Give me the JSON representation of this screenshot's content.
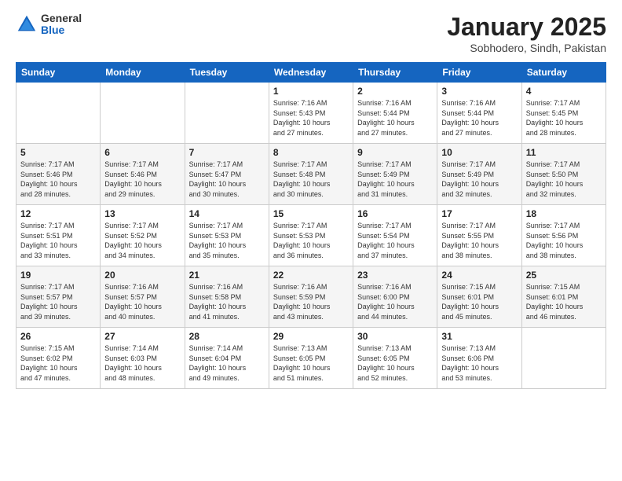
{
  "logo": {
    "general": "General",
    "blue": "Blue"
  },
  "header": {
    "title": "January 2025",
    "subtitle": "Sobhodero, Sindh, Pakistan"
  },
  "weekdays": [
    "Sunday",
    "Monday",
    "Tuesday",
    "Wednesday",
    "Thursday",
    "Friday",
    "Saturday"
  ],
  "weeks": [
    [
      {
        "day": "",
        "info": ""
      },
      {
        "day": "",
        "info": ""
      },
      {
        "day": "",
        "info": ""
      },
      {
        "day": "1",
        "info": "Sunrise: 7:16 AM\nSunset: 5:43 PM\nDaylight: 10 hours\nand 27 minutes."
      },
      {
        "day": "2",
        "info": "Sunrise: 7:16 AM\nSunset: 5:44 PM\nDaylight: 10 hours\nand 27 minutes."
      },
      {
        "day": "3",
        "info": "Sunrise: 7:16 AM\nSunset: 5:44 PM\nDaylight: 10 hours\nand 27 minutes."
      },
      {
        "day": "4",
        "info": "Sunrise: 7:17 AM\nSunset: 5:45 PM\nDaylight: 10 hours\nand 28 minutes."
      }
    ],
    [
      {
        "day": "5",
        "info": "Sunrise: 7:17 AM\nSunset: 5:46 PM\nDaylight: 10 hours\nand 28 minutes."
      },
      {
        "day": "6",
        "info": "Sunrise: 7:17 AM\nSunset: 5:46 PM\nDaylight: 10 hours\nand 29 minutes."
      },
      {
        "day": "7",
        "info": "Sunrise: 7:17 AM\nSunset: 5:47 PM\nDaylight: 10 hours\nand 30 minutes."
      },
      {
        "day": "8",
        "info": "Sunrise: 7:17 AM\nSunset: 5:48 PM\nDaylight: 10 hours\nand 30 minutes."
      },
      {
        "day": "9",
        "info": "Sunrise: 7:17 AM\nSunset: 5:49 PM\nDaylight: 10 hours\nand 31 minutes."
      },
      {
        "day": "10",
        "info": "Sunrise: 7:17 AM\nSunset: 5:49 PM\nDaylight: 10 hours\nand 32 minutes."
      },
      {
        "day": "11",
        "info": "Sunrise: 7:17 AM\nSunset: 5:50 PM\nDaylight: 10 hours\nand 32 minutes."
      }
    ],
    [
      {
        "day": "12",
        "info": "Sunrise: 7:17 AM\nSunset: 5:51 PM\nDaylight: 10 hours\nand 33 minutes."
      },
      {
        "day": "13",
        "info": "Sunrise: 7:17 AM\nSunset: 5:52 PM\nDaylight: 10 hours\nand 34 minutes."
      },
      {
        "day": "14",
        "info": "Sunrise: 7:17 AM\nSunset: 5:53 PM\nDaylight: 10 hours\nand 35 minutes."
      },
      {
        "day": "15",
        "info": "Sunrise: 7:17 AM\nSunset: 5:53 PM\nDaylight: 10 hours\nand 36 minutes."
      },
      {
        "day": "16",
        "info": "Sunrise: 7:17 AM\nSunset: 5:54 PM\nDaylight: 10 hours\nand 37 minutes."
      },
      {
        "day": "17",
        "info": "Sunrise: 7:17 AM\nSunset: 5:55 PM\nDaylight: 10 hours\nand 38 minutes."
      },
      {
        "day": "18",
        "info": "Sunrise: 7:17 AM\nSunset: 5:56 PM\nDaylight: 10 hours\nand 38 minutes."
      }
    ],
    [
      {
        "day": "19",
        "info": "Sunrise: 7:17 AM\nSunset: 5:57 PM\nDaylight: 10 hours\nand 39 minutes."
      },
      {
        "day": "20",
        "info": "Sunrise: 7:16 AM\nSunset: 5:57 PM\nDaylight: 10 hours\nand 40 minutes."
      },
      {
        "day": "21",
        "info": "Sunrise: 7:16 AM\nSunset: 5:58 PM\nDaylight: 10 hours\nand 41 minutes."
      },
      {
        "day": "22",
        "info": "Sunrise: 7:16 AM\nSunset: 5:59 PM\nDaylight: 10 hours\nand 43 minutes."
      },
      {
        "day": "23",
        "info": "Sunrise: 7:16 AM\nSunset: 6:00 PM\nDaylight: 10 hours\nand 44 minutes."
      },
      {
        "day": "24",
        "info": "Sunrise: 7:15 AM\nSunset: 6:01 PM\nDaylight: 10 hours\nand 45 minutes."
      },
      {
        "day": "25",
        "info": "Sunrise: 7:15 AM\nSunset: 6:01 PM\nDaylight: 10 hours\nand 46 minutes."
      }
    ],
    [
      {
        "day": "26",
        "info": "Sunrise: 7:15 AM\nSunset: 6:02 PM\nDaylight: 10 hours\nand 47 minutes."
      },
      {
        "day": "27",
        "info": "Sunrise: 7:14 AM\nSunset: 6:03 PM\nDaylight: 10 hours\nand 48 minutes."
      },
      {
        "day": "28",
        "info": "Sunrise: 7:14 AM\nSunset: 6:04 PM\nDaylight: 10 hours\nand 49 minutes."
      },
      {
        "day": "29",
        "info": "Sunrise: 7:13 AM\nSunset: 6:05 PM\nDaylight: 10 hours\nand 51 minutes."
      },
      {
        "day": "30",
        "info": "Sunrise: 7:13 AM\nSunset: 6:05 PM\nDaylight: 10 hours\nand 52 minutes."
      },
      {
        "day": "31",
        "info": "Sunrise: 7:13 AM\nSunset: 6:06 PM\nDaylight: 10 hours\nand 53 minutes."
      },
      {
        "day": "",
        "info": ""
      }
    ]
  ]
}
